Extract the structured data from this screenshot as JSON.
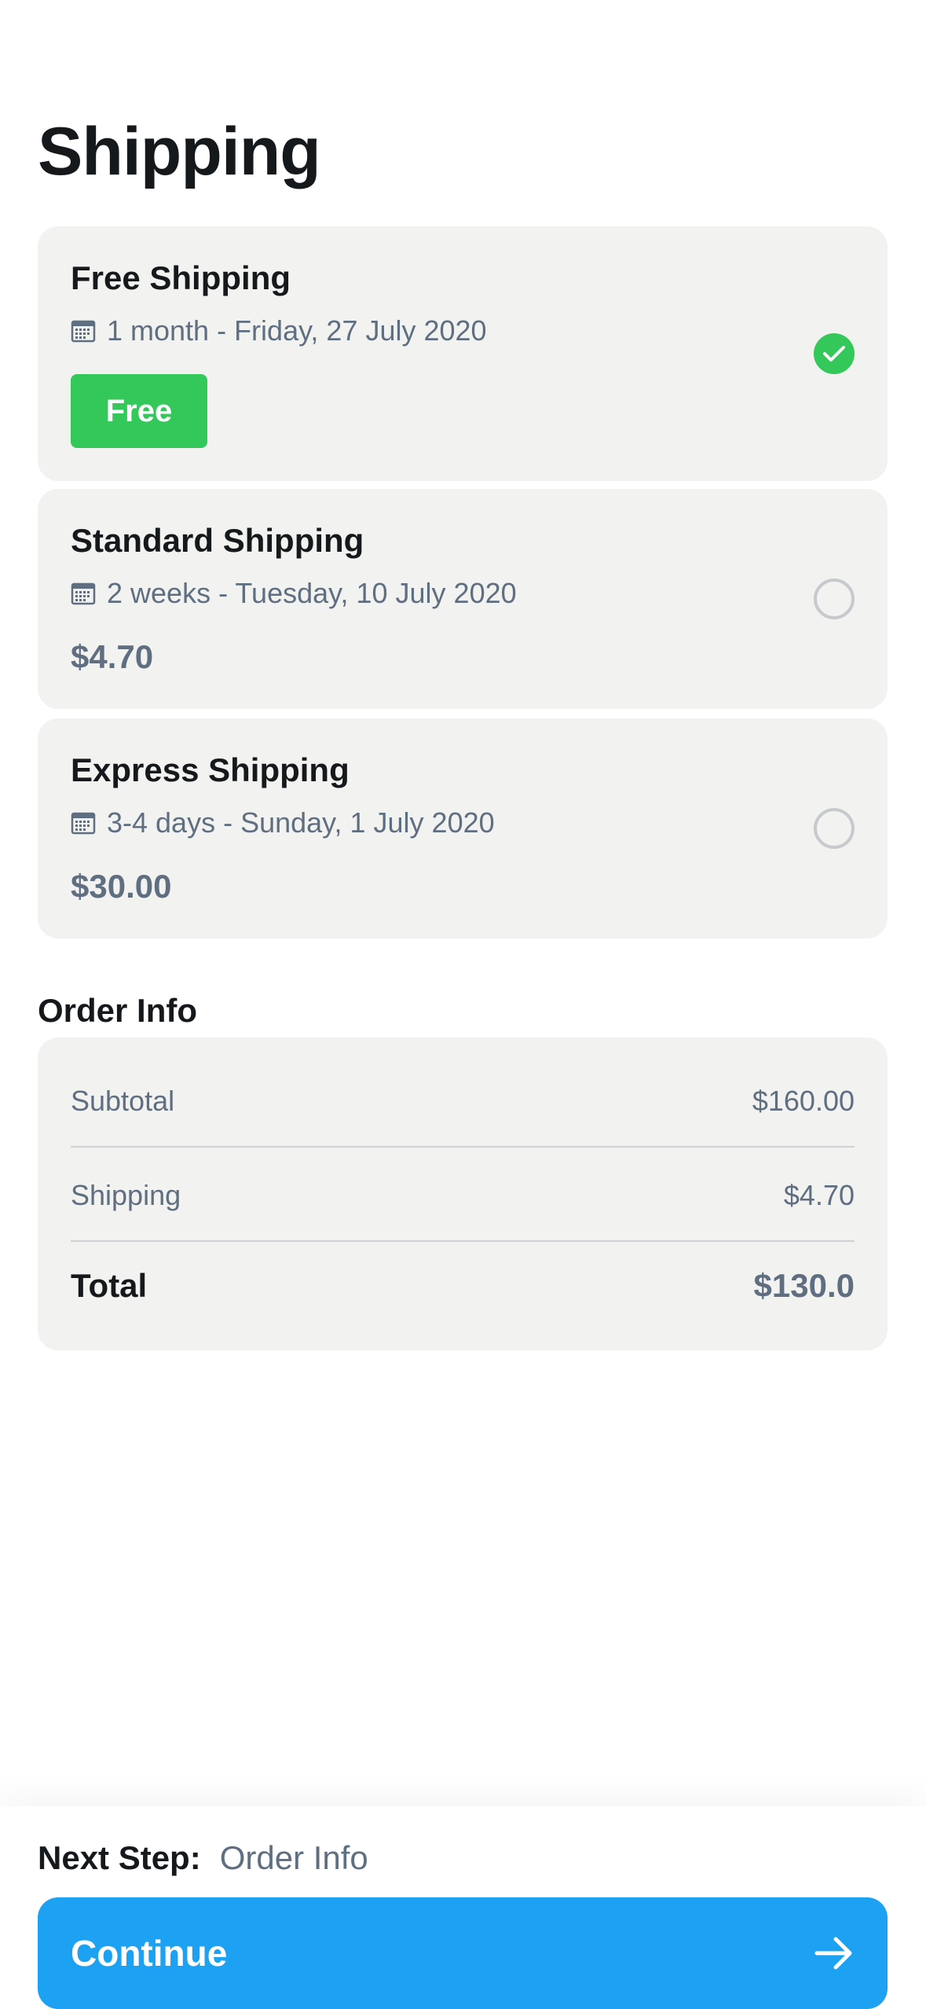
{
  "page": {
    "title": "Shipping"
  },
  "shipping_options": [
    {
      "name": "Free Shipping",
      "date": "1 month - Friday, 27 July 2020",
      "price_label": "Free",
      "selected": true
    },
    {
      "name": "Standard Shipping",
      "date": "2 weeks - Tuesday, 10 July 2020",
      "price_label": "$4.70",
      "selected": false
    },
    {
      "name": "Express Shipping",
      "date": "3-4 days - Sunday, 1 July 2020",
      "price_label": "$30.00",
      "selected": false
    }
  ],
  "order_info": {
    "title": "Order Info",
    "subtotal_label": "Subtotal",
    "subtotal_value": "$160.00",
    "shipping_label": "Shipping",
    "shipping_value": "$4.70",
    "total_label": "Total",
    "total_value": "$130.0"
  },
  "footer": {
    "next_step_label": "Next Step:",
    "next_step_value": "Order Info",
    "continue_label": "Continue"
  },
  "icons": {
    "date": "calendar-icon",
    "selected": "checkmark-icon",
    "continue": "arrow-right-icon"
  },
  "colors": {
    "accent_green": "#34c759",
    "primary_blue": "#1da1f2",
    "card_bg": "#f2f2f1",
    "muted_text": "#5f6e80",
    "text": "#16191c"
  }
}
